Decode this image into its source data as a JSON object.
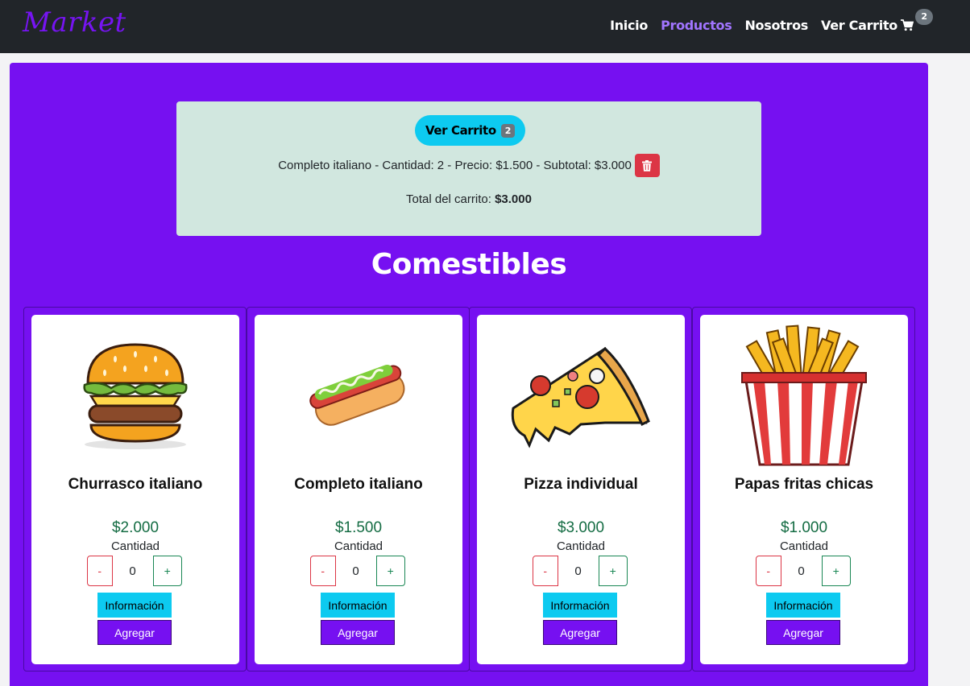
{
  "navbar": {
    "brand": "Market",
    "links": [
      "Inicio",
      "Productos",
      "Nosotros"
    ],
    "cart_label": "Ver Carrito",
    "cart_count": "2"
  },
  "cart": {
    "button_label": "Ver Carrito",
    "badge": "2",
    "line": "Completo italiano - Cantidad: 2 - Precio: $1.500 - Subtotal: $3.000",
    "total_label": "Total del carrito:",
    "total_value": "$3.000"
  },
  "section": {
    "title": "Comestibles"
  },
  "products": [
    {
      "name": "Churrasco italiano",
      "price": "$2.000",
      "qty_label": "Cantidad",
      "qty": "0",
      "minus": "-",
      "plus": "+",
      "info": "Información",
      "add": "Agregar",
      "icon": "burger"
    },
    {
      "name": "Completo italiano",
      "price": "$1.500",
      "qty_label": "Cantidad",
      "qty": "0",
      "minus": "-",
      "plus": "+",
      "info": "Información",
      "add": "Agregar",
      "icon": "hotdog"
    },
    {
      "name": "Pizza individual",
      "price": "$3.000",
      "qty_label": "Cantidad",
      "qty": "0",
      "minus": "-",
      "plus": "+",
      "info": "Información",
      "add": "Agregar",
      "icon": "pizza"
    },
    {
      "name": "Papas fritas chicas",
      "price": "$1.000",
      "qty_label": "Cantidad",
      "qty": "0",
      "minus": "-",
      "plus": "+",
      "info": "Información",
      "add": "Agregar",
      "icon": "fries"
    }
  ],
  "colors": {
    "navbar": "#212529",
    "primary": "#7610f1",
    "info": "#0dcaf0",
    "danger": "#dc3545",
    "success": "#198754",
    "cart_bg": "#d1e7df"
  }
}
